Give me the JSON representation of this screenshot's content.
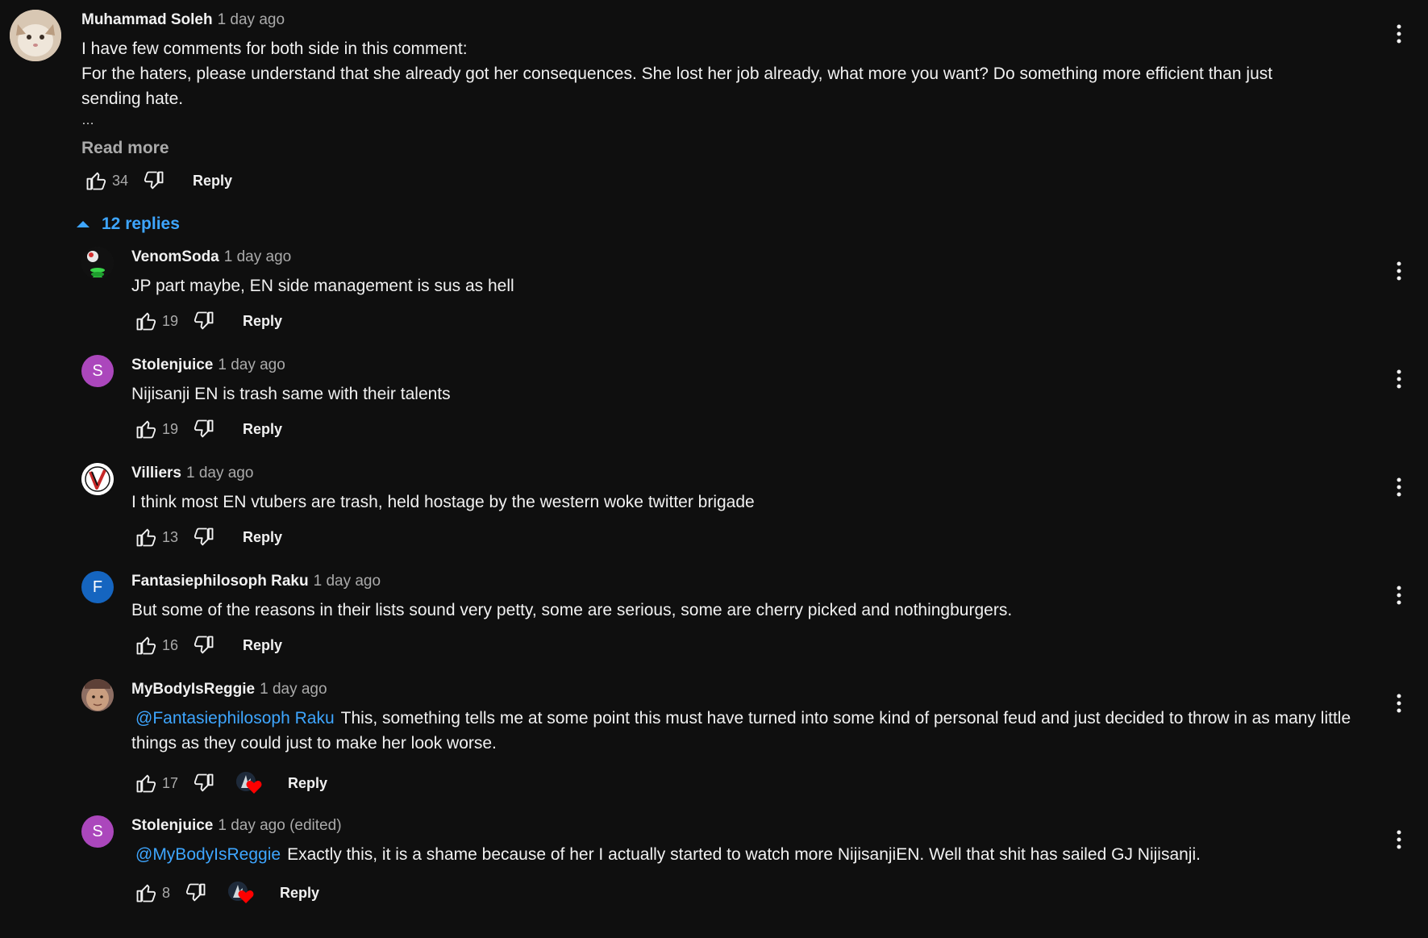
{
  "main_comment": {
    "author": "Muhammad Soleh",
    "time": "1 day ago",
    "text_lines": [
      "I have few comments for both side in this comment:",
      "For the haters, please understand that she already got her consequences. She lost her job already, what more you want? Do something more efficient than just",
      "sending hate."
    ],
    "ellipsis": "…",
    "read_more_label": "Read more",
    "likes": "34",
    "reply_label": "Reply"
  },
  "replies_toggle": {
    "label": "12 replies"
  },
  "replies": [
    {
      "author": "VenomSoda",
      "time": "1 day ago",
      "mention": "",
      "text": "JP part maybe, EN side management is sus as hell",
      "likes": "19",
      "reply_label": "Reply",
      "avatar_letter": "",
      "avatar_color": "#1c1c1c"
    },
    {
      "author": "Stolenjuice",
      "time": "1 day ago",
      "mention": "",
      "text": "Nijisanji EN is trash same with their talents",
      "likes": "19",
      "reply_label": "Reply",
      "avatar_letter": "S",
      "avatar_color": "#ab47bc"
    },
    {
      "author": "Villiers",
      "time": "1 day ago",
      "mention": "",
      "text": "I think most EN vtubers are trash, held hostage by the western woke twitter brigade",
      "likes": "13",
      "reply_label": "Reply",
      "avatar_letter": "",
      "avatar_color": "#ffffff"
    },
    {
      "author": "Fantasiephilosoph Raku",
      "time": "1 day ago",
      "mention": "",
      "text": "But some of the reasons in their lists sound very petty, some are serious, some are cherry picked and nothingburgers.",
      "likes": "16",
      "reply_label": "Reply",
      "avatar_letter": "F",
      "avatar_color": "#1565c0"
    },
    {
      "author": "MyBodyIsReggie",
      "time": "1 day ago",
      "mention": "@Fantasiephilosoph Raku",
      "text": "This, something tells me at some point this must have turned into some kind of personal feud and just decided to throw in as many little things as they could just to make her look worse.",
      "likes": "17",
      "reply_label": "Reply",
      "avatar_letter": "",
      "avatar_color": "#6d4c41",
      "creator_heart": true
    },
    {
      "author": "Stolenjuice",
      "time": "1 day ago (edited)",
      "mention": "@MyBodyIsReggie",
      "text": "Exactly this, it is a shame because of her I actually started to watch more NijisanjiEN. Well that shit has sailed GJ Nijisanji.",
      "likes": "8",
      "reply_label": "Reply",
      "avatar_letter": "S",
      "avatar_color": "#ab47bc",
      "creator_heart": true
    }
  ],
  "colors": {
    "background": "#0f0f0f",
    "link_blue": "#3ea6ff",
    "muted": "#aaaaaa",
    "heart_red": "#ff0000"
  },
  "icons": [
    "thumb-up-icon",
    "thumb-down-icon",
    "more-vert-icon",
    "chevron-up-icon",
    "heart-icon"
  ]
}
